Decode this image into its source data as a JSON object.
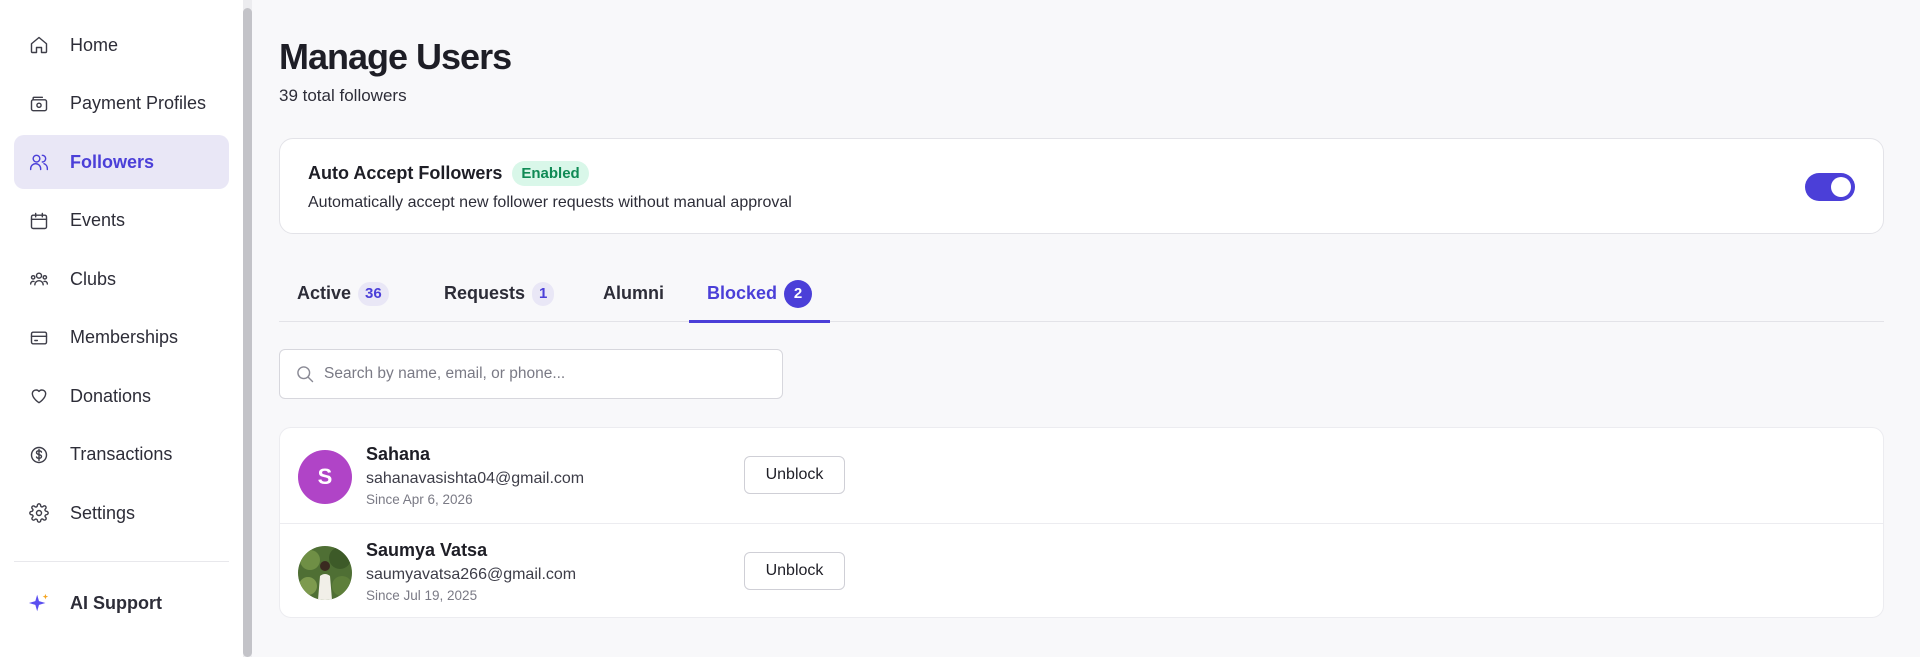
{
  "sidebar": {
    "items": [
      {
        "label": "Home",
        "icon": "home-icon",
        "active": false
      },
      {
        "label": "Payment Profiles",
        "icon": "wallet-icon",
        "active": false
      },
      {
        "label": "Followers",
        "icon": "users-icon",
        "active": true
      },
      {
        "label": "Events",
        "icon": "calendar-icon",
        "active": false
      },
      {
        "label": "Clubs",
        "icon": "group-icon",
        "active": false
      },
      {
        "label": "Memberships",
        "icon": "card-icon",
        "active": false
      },
      {
        "label": "Donations",
        "icon": "heart-icon",
        "active": false
      },
      {
        "label": "Transactions",
        "icon": "dollar-circle-icon",
        "active": false
      },
      {
        "label": "Settings",
        "icon": "gear-icon",
        "active": false
      }
    ],
    "ai_support": {
      "label": "AI Support",
      "icon": "sparkle-icon"
    }
  },
  "header": {
    "title": "Manage Users",
    "subtitle": "39 total followers"
  },
  "auto_accept": {
    "title": "Auto Accept Followers",
    "badge": "Enabled",
    "description": "Automatically accept new follower requests without manual approval",
    "enabled": true
  },
  "tabs": [
    {
      "label": "Active",
      "count": "36",
      "active": false
    },
    {
      "label": "Requests",
      "count": "1",
      "active": false
    },
    {
      "label": "Alumni",
      "count": null,
      "active": false
    },
    {
      "label": "Blocked",
      "count": "2",
      "active": true
    }
  ],
  "search": {
    "placeholder": "Search by name, email, or phone...",
    "value": ""
  },
  "blocked_users": [
    {
      "name": "Sahana",
      "initial": "S",
      "email": "sahanavasishta04@gmail.com",
      "since": "Since Apr 6, 2026",
      "action": "Unblock",
      "avatar_color": "#b044c7",
      "avatar_type": "initial"
    },
    {
      "name": "Saumya Vatsa",
      "initial": "",
      "email": "saumyavatsa266@gmail.com",
      "since": "Since Jul 19, 2025",
      "action": "Unblock",
      "avatar_color": "#5a7a3a",
      "avatar_type": "photo"
    }
  ],
  "colors": {
    "accent": "#4b3fd8",
    "success_bg": "#d9f7e9",
    "success_text": "#0f8a55"
  }
}
